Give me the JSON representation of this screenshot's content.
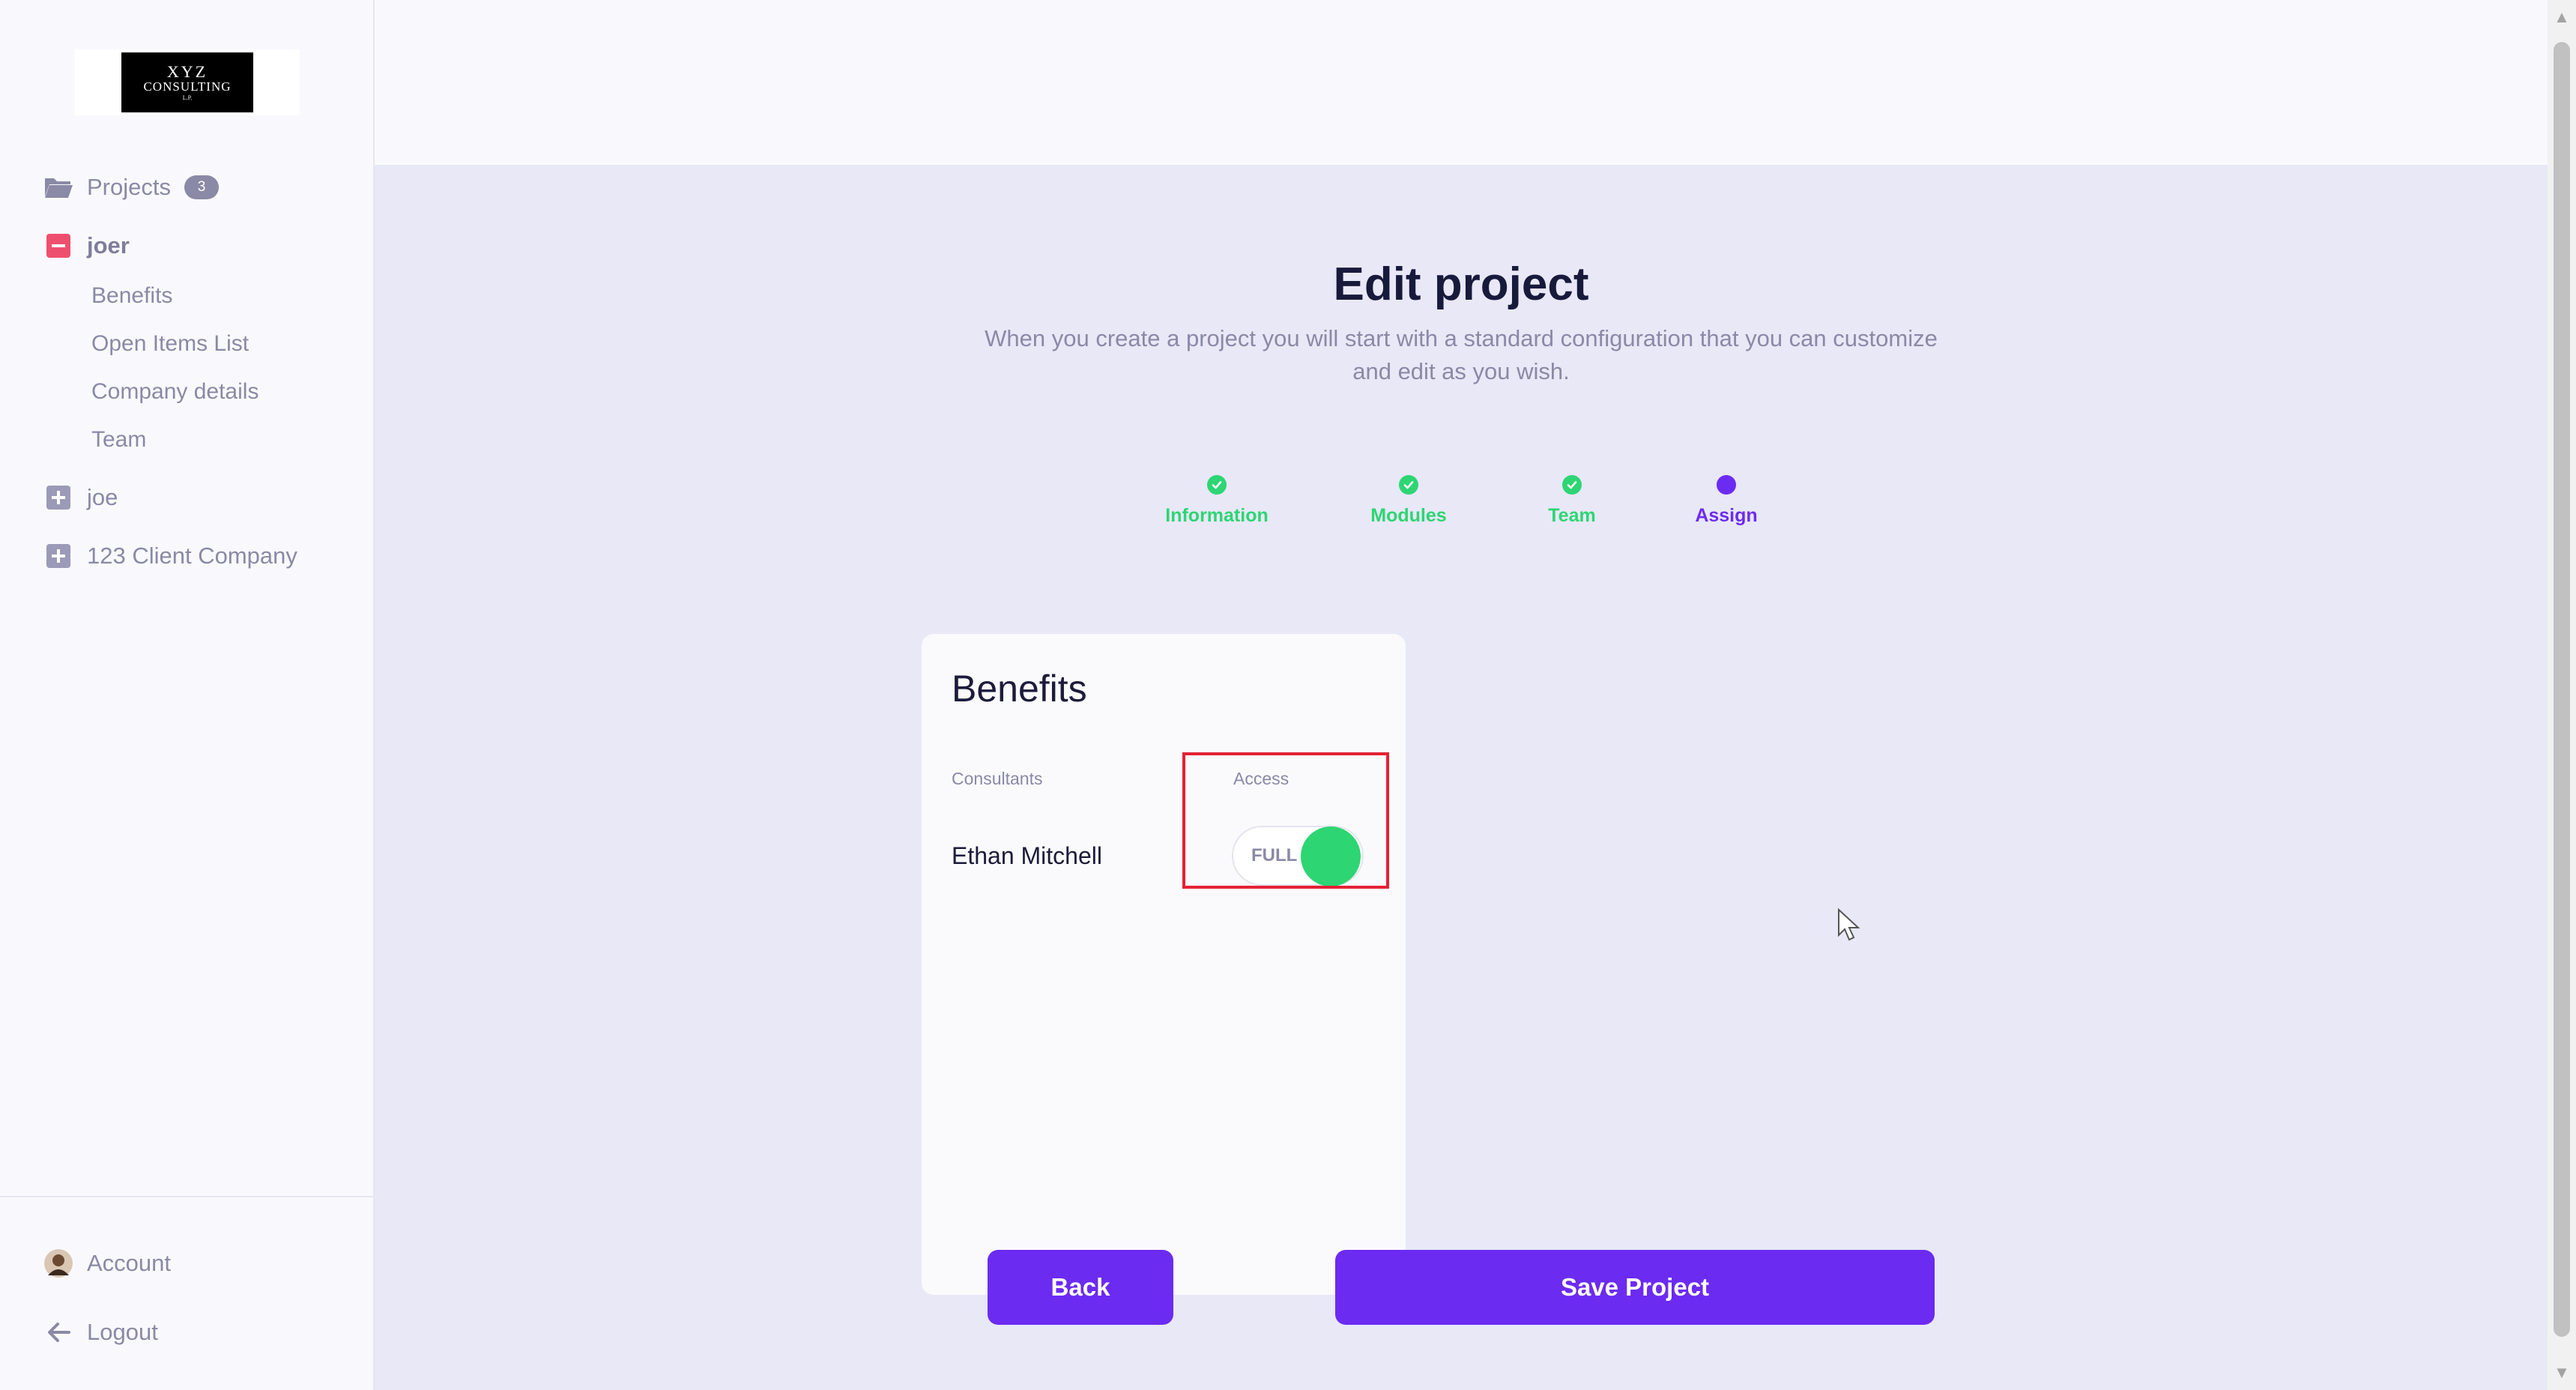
{
  "sidebar": {
    "logo": {
      "line1": "XYZ",
      "line2": "CONSULTING",
      "line3": "L.P."
    },
    "projects": {
      "label": "Projects",
      "count": "3"
    },
    "expanded_project": {
      "label": "joer",
      "items": [
        "Benefits",
        "Open Items List",
        "Company details",
        "Team"
      ]
    },
    "collapsed_projects": [
      "joe",
      "123 Client Company"
    ],
    "account_label": "Account",
    "logout_label": "Logout"
  },
  "main": {
    "title": "Edit project",
    "subtitle": "When you create a project you will start with a standard configuration that you can customize and edit as you wish.",
    "steps": [
      {
        "label": "Information",
        "state": "done"
      },
      {
        "label": "Modules",
        "state": "done"
      },
      {
        "label": "Team",
        "state": "done"
      },
      {
        "label": "Assign",
        "state": "current"
      }
    ],
    "card": {
      "title": "Benefits",
      "col_consultants": "Consultants",
      "col_access": "Access",
      "consultant_name": "Ethan Mitchell",
      "access_value": "FULL",
      "access_enabled": true
    },
    "back_label": "Back",
    "save_label": "Save Project"
  },
  "colors": {
    "accent": "#6c2bf1",
    "done": "#2ed573",
    "danger": "#ef4f6e",
    "highlight": "#e32235"
  }
}
